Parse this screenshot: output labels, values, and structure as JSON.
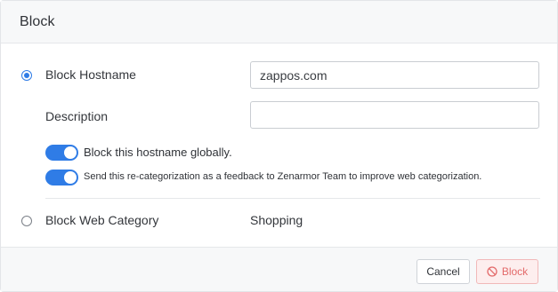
{
  "dialog": {
    "title": "Block"
  },
  "options": {
    "block_hostname": {
      "label": "Block Hostname",
      "selected": true,
      "hostname_value": "zappos.com"
    },
    "description": {
      "label": "Description",
      "value": ""
    },
    "toggle_global": {
      "label": "Block this hostname globally.",
      "on": true
    },
    "toggle_feedback": {
      "label": "Send this re-categorization as a feedback to Zenarmor Team to improve web categorization.",
      "on": true
    },
    "block_category": {
      "label": "Block Web Category",
      "selected": false,
      "value": "Shopping"
    }
  },
  "footer": {
    "cancel_label": "Cancel",
    "block_label": "Block"
  },
  "colors": {
    "accent": "#2f7ce6",
    "danger_text": "#e36a6a",
    "danger_bg": "#fdeeee"
  },
  "icons": {
    "block_button_icon": "ban-icon"
  }
}
